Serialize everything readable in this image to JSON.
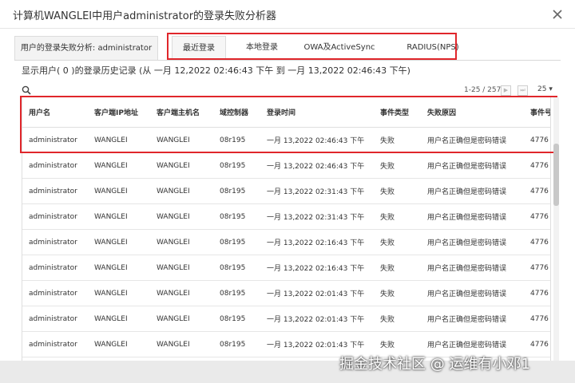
{
  "window": {
    "title": "计算机WANGLEI中用户administrator的登录失败分析器"
  },
  "tabs": {
    "user_analysis": "用户的登录失败分析: administrator",
    "items": [
      "最近登录",
      "本地登录",
      "OWA及ActiveSync",
      "RADIUS(NPS)"
    ]
  },
  "summary": "显示用户( 0 )的登录历史记录 (从 一月 12,2022 02:46:43 下午 到 一月 13,2022 02:46:43 下午)",
  "pager": {
    "range": "1-25 / 257",
    "next": "▶",
    "last": "⏭",
    "page_size": "25 ▾"
  },
  "table": {
    "headers": [
      "用户名",
      "客户端IP地址",
      "客户端主机名",
      "域控制器",
      "登录时间",
      "事件类型",
      "失败原因",
      "事件号"
    ],
    "rows": [
      [
        "administrator",
        "WANGLEI",
        "WANGLEI",
        "08r195",
        "一月 13,2022 02:46:43 下午",
        "失败",
        "用户名正确但是密码错误",
        "4776"
      ],
      [
        "administrator",
        "WANGLEI",
        "WANGLEI",
        "08r195",
        "一月 13,2022 02:46:43 下午",
        "失败",
        "用户名正确但是密码错误",
        "4776"
      ],
      [
        "administrator",
        "WANGLEI",
        "WANGLEI",
        "08r195",
        "一月 13,2022 02:31:43 下午",
        "失败",
        "用户名正确但是密码错误",
        "4776"
      ],
      [
        "administrator",
        "WANGLEI",
        "WANGLEI",
        "08r195",
        "一月 13,2022 02:31:43 下午",
        "失败",
        "用户名正确但是密码错误",
        "4776"
      ],
      [
        "administrator",
        "WANGLEI",
        "WANGLEI",
        "08r195",
        "一月 13,2022 02:16:43 下午",
        "失败",
        "用户名正确但是密码错误",
        "4776"
      ],
      [
        "administrator",
        "WANGLEI",
        "WANGLEI",
        "08r195",
        "一月 13,2022 02:16:43 下午",
        "失败",
        "用户名正确但是密码错误",
        "4776"
      ],
      [
        "administrator",
        "WANGLEI",
        "WANGLEI",
        "08r195",
        "一月 13,2022 02:01:43 下午",
        "失败",
        "用户名正确但是密码错误",
        "4776"
      ],
      [
        "administrator",
        "WANGLEI",
        "WANGLEI",
        "08r195",
        "一月 13,2022 02:01:43 下午",
        "失败",
        "用户名正确但是密码错误",
        "4776"
      ],
      [
        "administrator",
        "WANGLEI",
        "WANGLEI",
        "08r195",
        "一月 13,2022 02:01:43 下午",
        "失败",
        "用户名正确但是密码错误",
        "4776"
      ]
    ]
  },
  "watermark": "掘金技术社区 @ 运维有小邓1",
  "colors": {
    "highlight_border": "#e0262b"
  },
  "icons": {
    "close": "close-icon",
    "search": "search-icon"
  }
}
